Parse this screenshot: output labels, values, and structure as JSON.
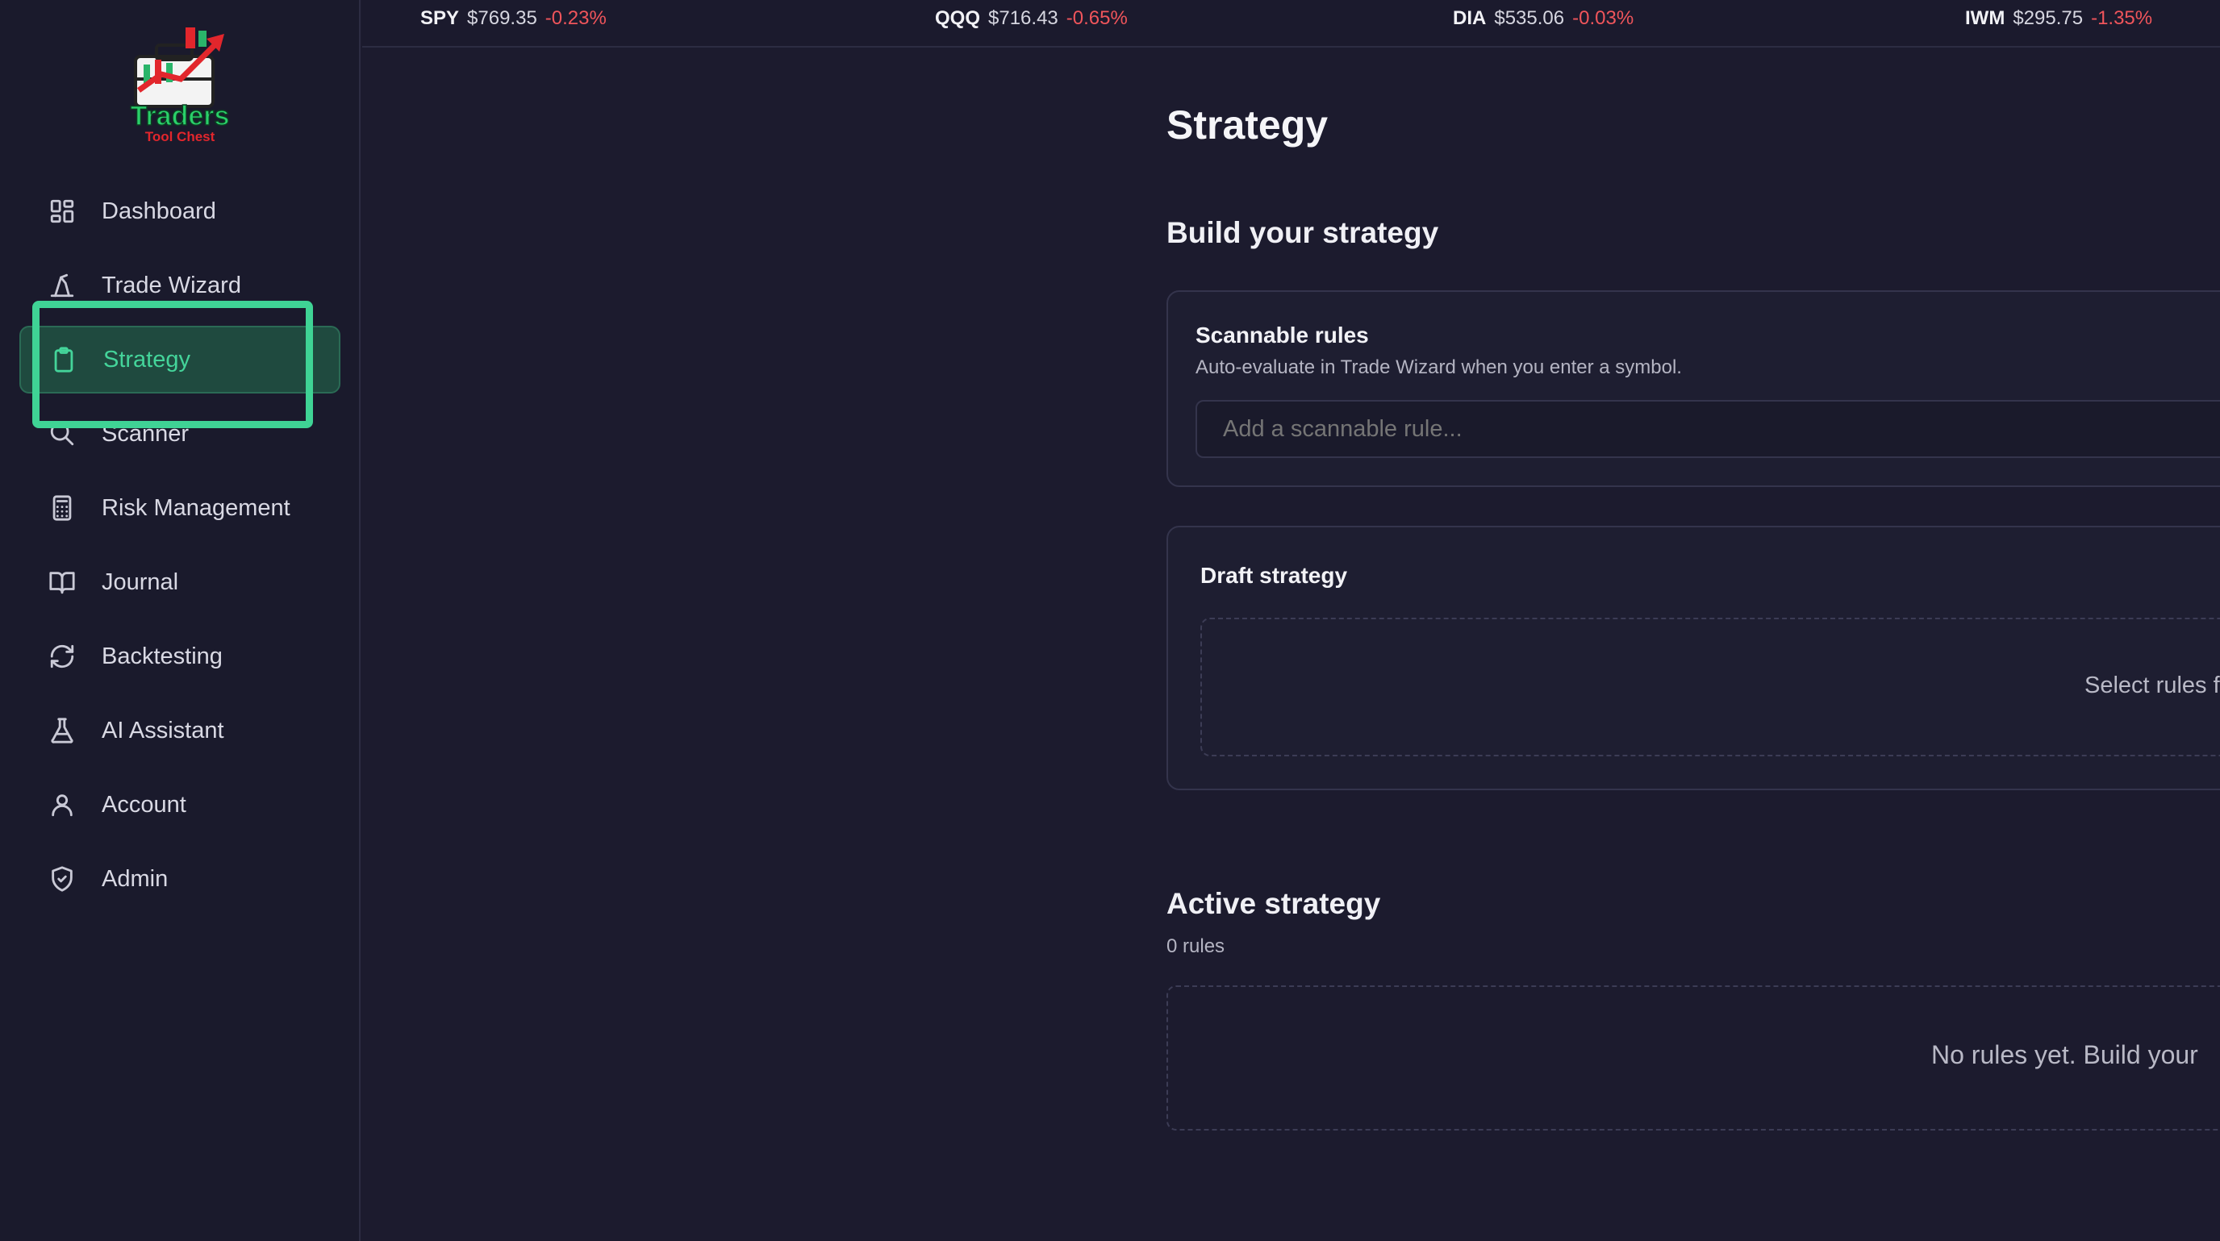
{
  "app": {
    "logo_text": "Traders",
    "logo_subtext": "Tool Chest"
  },
  "sidebar": {
    "items": [
      {
        "label": "Dashboard",
        "icon": "grid-icon"
      },
      {
        "label": "Trade Wizard",
        "icon": "wizard-hat-icon"
      },
      {
        "label": "Strategy",
        "icon": "clipboard-icon",
        "active": true
      },
      {
        "label": "Scanner",
        "icon": "search-icon"
      },
      {
        "label": "Risk Management",
        "icon": "calculator-icon"
      },
      {
        "label": "Journal",
        "icon": "book-open-icon"
      },
      {
        "label": "Backtesting",
        "icon": "refresh-icon"
      },
      {
        "label": "AI Assistant",
        "icon": "flask-icon"
      },
      {
        "label": "Account",
        "icon": "user-icon"
      },
      {
        "label": "Admin",
        "icon": "shield-icon"
      }
    ]
  },
  "ticker": [
    {
      "symbol": "SPY",
      "price": "$769.35",
      "change": "-0.23%"
    },
    {
      "symbol": "QQQ",
      "price": "$716.43",
      "change": "-0.65%"
    },
    {
      "symbol": "DIA",
      "price": "$535.06",
      "change": "-0.03%"
    },
    {
      "symbol": "IWM",
      "price": "$295.75",
      "change": "-1.35%"
    }
  ],
  "main": {
    "title": "Strategy",
    "build_title": "Build your strategy",
    "scannable": {
      "title": "Scannable rules",
      "subtitle": "Auto-evaluate in Trade Wizard when you enter a symbol.",
      "input_placeholder": "Add a scannable rule..."
    },
    "draft": {
      "title": "Draft strategy",
      "placeholder": "Select rules f"
    },
    "active": {
      "title": "Active strategy",
      "count": "0 rules",
      "empty_text": "No rules yet. Build your"
    }
  },
  "colors": {
    "accent": "#44d49a",
    "negative": "#f0555b",
    "background": "#1c1b2e"
  }
}
